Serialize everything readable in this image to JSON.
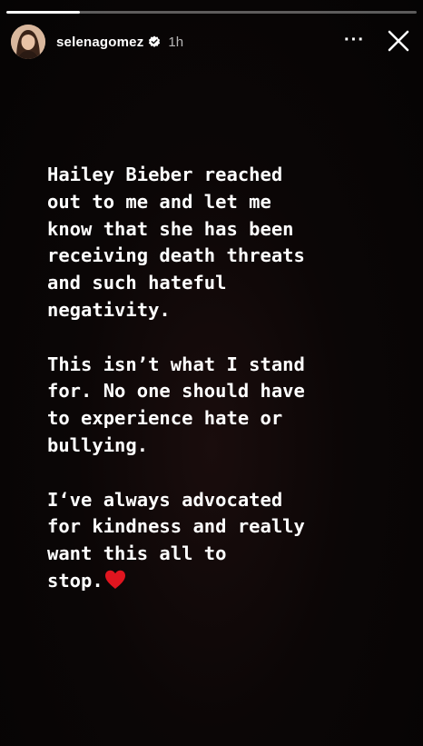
{
  "story": {
    "progress": 0.18,
    "username": "selenagomez",
    "verified": true,
    "time": "1h",
    "more_label": "···",
    "paragraphs": [
      [
        "Hailey Bieber reached",
        "out to me and let me",
        "know that she has been",
        "receiving death threats",
        "and such hateful",
        "negativity."
      ],
      [
        "This isn’t what I stand",
        "for. No one should have",
        "to experience hate or",
        "bullying."
      ],
      [
        "I‘ve always advocated",
        "for kindness and really",
        "want this all to",
        "stop."
      ]
    ]
  },
  "colors": {
    "text": "#ffffff",
    "heart": "#e0151f",
    "verified": "#ffffff"
  },
  "icons": [
    "avatar",
    "verified-badge-icon",
    "more-icon",
    "close-icon",
    "heart-icon"
  ]
}
